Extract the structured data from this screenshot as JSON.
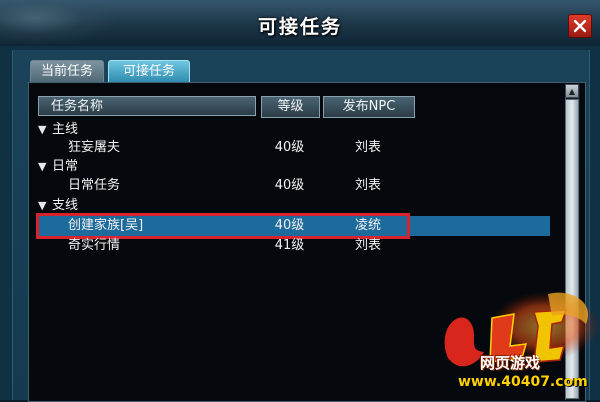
{
  "window": {
    "title": "可接任务"
  },
  "tabs": [
    {
      "label": "当前任务",
      "active": false
    },
    {
      "label": "可接任务",
      "active": true
    }
  ],
  "table": {
    "columns": [
      "任务名称",
      "等级",
      "发布NPC"
    ],
    "groups": [
      {
        "name": "主线",
        "quests": [
          {
            "name": "狂妄屠夫",
            "level": "40级",
            "npc": "刘表"
          }
        ]
      },
      {
        "name": "日常",
        "quests": [
          {
            "name": "日常任务",
            "level": "40级",
            "npc": "刘表"
          }
        ]
      },
      {
        "name": "支线",
        "quests": [
          {
            "name": "创建家族[吴]",
            "level": "40级",
            "npc": "凌统",
            "selected": true
          },
          {
            "name": "奇实行情",
            "level": "41级",
            "npc": "刘表"
          }
        ]
      }
    ]
  },
  "watermark": {
    "site_name": "网页游戏",
    "url": "www.40407.com"
  },
  "colors": {
    "selection": "#1d6a9c",
    "highlight_box": "#d8232e",
    "active_tab": "#2c89ad"
  }
}
